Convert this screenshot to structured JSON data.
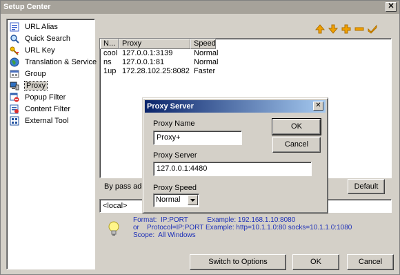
{
  "window": {
    "title": "Setup Center",
    "close_glyph": "✕"
  },
  "sidebar": {
    "items": [
      {
        "label": "URL Alias",
        "icon": "url-alias-icon"
      },
      {
        "label": "Quick Search",
        "icon": "quick-search-icon"
      },
      {
        "label": "URL Key",
        "icon": "url-key-icon"
      },
      {
        "label": "Translation & Service",
        "icon": "globe-icon"
      },
      {
        "label": "Group",
        "icon": "group-icon"
      },
      {
        "label": "Proxy",
        "icon": "proxy-icon",
        "selected": true
      },
      {
        "label": "Popup Filter",
        "icon": "popup-filter-icon"
      },
      {
        "label": "Content Filter",
        "icon": "content-filter-icon"
      },
      {
        "label": "External Tool",
        "icon": "external-tool-icon"
      }
    ]
  },
  "toolbar": {
    "buttons": [
      "move-up-icon",
      "move-down-icon",
      "add-icon",
      "remove-icon",
      "check-icon"
    ],
    "colors": {
      "arrows": "#f0a000",
      "plus": "#f0a000",
      "check": "#f0a000"
    }
  },
  "proxy_list": {
    "columns": [
      "N...",
      "Proxy",
      "Speed"
    ],
    "rows": [
      {
        "name": "cool",
        "proxy": "127.0.0.1:3139",
        "speed": "Normal"
      },
      {
        "name": "ns",
        "proxy": "127.0.0.1:81",
        "speed": "Normal"
      },
      {
        "name": "1up",
        "proxy": "172.28.102.25:8082",
        "speed": "Faster"
      }
    ]
  },
  "bypass": {
    "label": "By pass addr",
    "value": "<local>",
    "default_button": "Default"
  },
  "hint": {
    "line1": "Format:  IP:PORT          Example: 192.168.1.10:8080",
    "line2": "or    Protocol=IP:PORT Example: http=10.1.1.0:80 socks=10.1.1.0:1080",
    "line3": "Scope:  All Windows"
  },
  "footer": {
    "switch_label": "Switch to Options",
    "ok_label": "OK",
    "cancel_label": "Cancel"
  },
  "dialog": {
    "title": "Proxy Server",
    "close_glyph": "✕",
    "name_label": "Proxy Name",
    "name_value": "Proxy+",
    "server_label": "Proxy Server",
    "server_value": "127.0.0.1:4480",
    "speed_label": "Proxy Speed",
    "speed_value": "Normal",
    "ok_label": "OK",
    "cancel_label": "Cancel"
  }
}
